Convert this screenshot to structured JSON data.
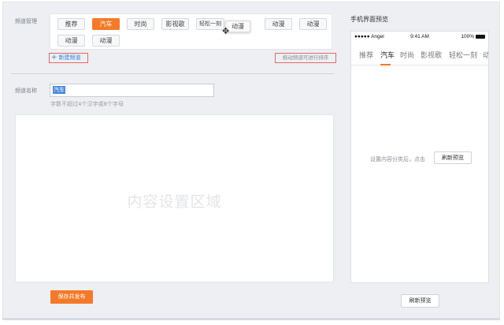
{
  "channel_manager": {
    "label": "频道管理",
    "chips": [
      {
        "label": "推荐",
        "active": false
      },
      {
        "label": "汽车",
        "active": true
      },
      {
        "label": "时尚",
        "active": false
      },
      {
        "label": "影视歌",
        "active": false
      },
      {
        "label": "轻松一刻",
        "active": false
      },
      {
        "label": "动漫",
        "active": false
      },
      {
        "label": "动漫",
        "active": false
      },
      {
        "label": "动漫",
        "active": false
      },
      {
        "label": "动漫",
        "active": false
      }
    ],
    "dragging_chip": "动漫",
    "add_button": "新建频道",
    "drag_hint": "拖动频道可进行排序"
  },
  "channel_name": {
    "label": "频道名称",
    "value": "汽车",
    "hint": "字数不超过4个汉字或8个字母"
  },
  "content": {
    "placeholder": "内容设置区域"
  },
  "save_button": "保存并发布",
  "preview": {
    "title": "手机界面预览",
    "status": {
      "carrier": "●●●●● Angel",
      "time": "9:41 AM",
      "battery": "100%"
    },
    "tabs": [
      "推荐",
      "汽车",
      "时尚",
      "影视歌",
      "轻松一刻",
      "动"
    ],
    "active_tab": "汽车",
    "hint": "设置内容分类后，点击",
    "refresh_inline": "刷新预览",
    "refresh_button": "刷新预览"
  },
  "colors": {
    "accent": "#f47a2a",
    "link": "#3a7fd5",
    "outline": "#e06a6a"
  }
}
